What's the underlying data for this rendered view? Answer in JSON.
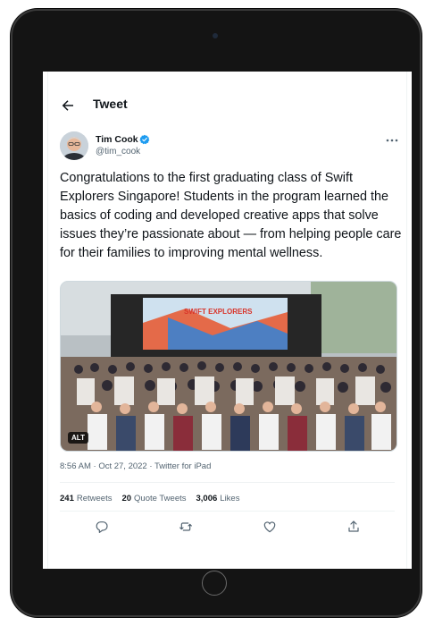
{
  "header": {
    "title": "Tweet"
  },
  "author": {
    "name": "Tim Cook",
    "handle": "@tim_cook"
  },
  "tweet": {
    "text": "Congratulations to the first graduating class of Swift Explorers Singapore! Students in the program learned the basics of coding and developed creative apps that solve issues they’re passionate about — from helping people care for their families to improving mental wellness."
  },
  "media": {
    "alt_label": "ALT",
    "banner_text": "SWIFT EXPLORERS"
  },
  "meta": {
    "time": "8:56 AM",
    "separator": " · ",
    "date": "Oct 27, 2022",
    "source": "Twitter for iPad"
  },
  "stats": {
    "retweets": {
      "count": "241",
      "label": "Retweets"
    },
    "quote_tweets": {
      "count": "20",
      "label": "Quote Tweets"
    },
    "likes": {
      "count": "3,006",
      "label": "Likes"
    }
  },
  "icons": {
    "back": "arrow-left-icon",
    "verified": "verified-badge-icon",
    "more": "more-horizontal-icon",
    "reply": "reply-icon",
    "retweet": "retweet-icon",
    "like": "heart-icon",
    "share": "share-icon"
  },
  "colors": {
    "text": "#0f1419",
    "secondary": "#536471",
    "verified": "#1d9bf0",
    "device": "#141414"
  }
}
